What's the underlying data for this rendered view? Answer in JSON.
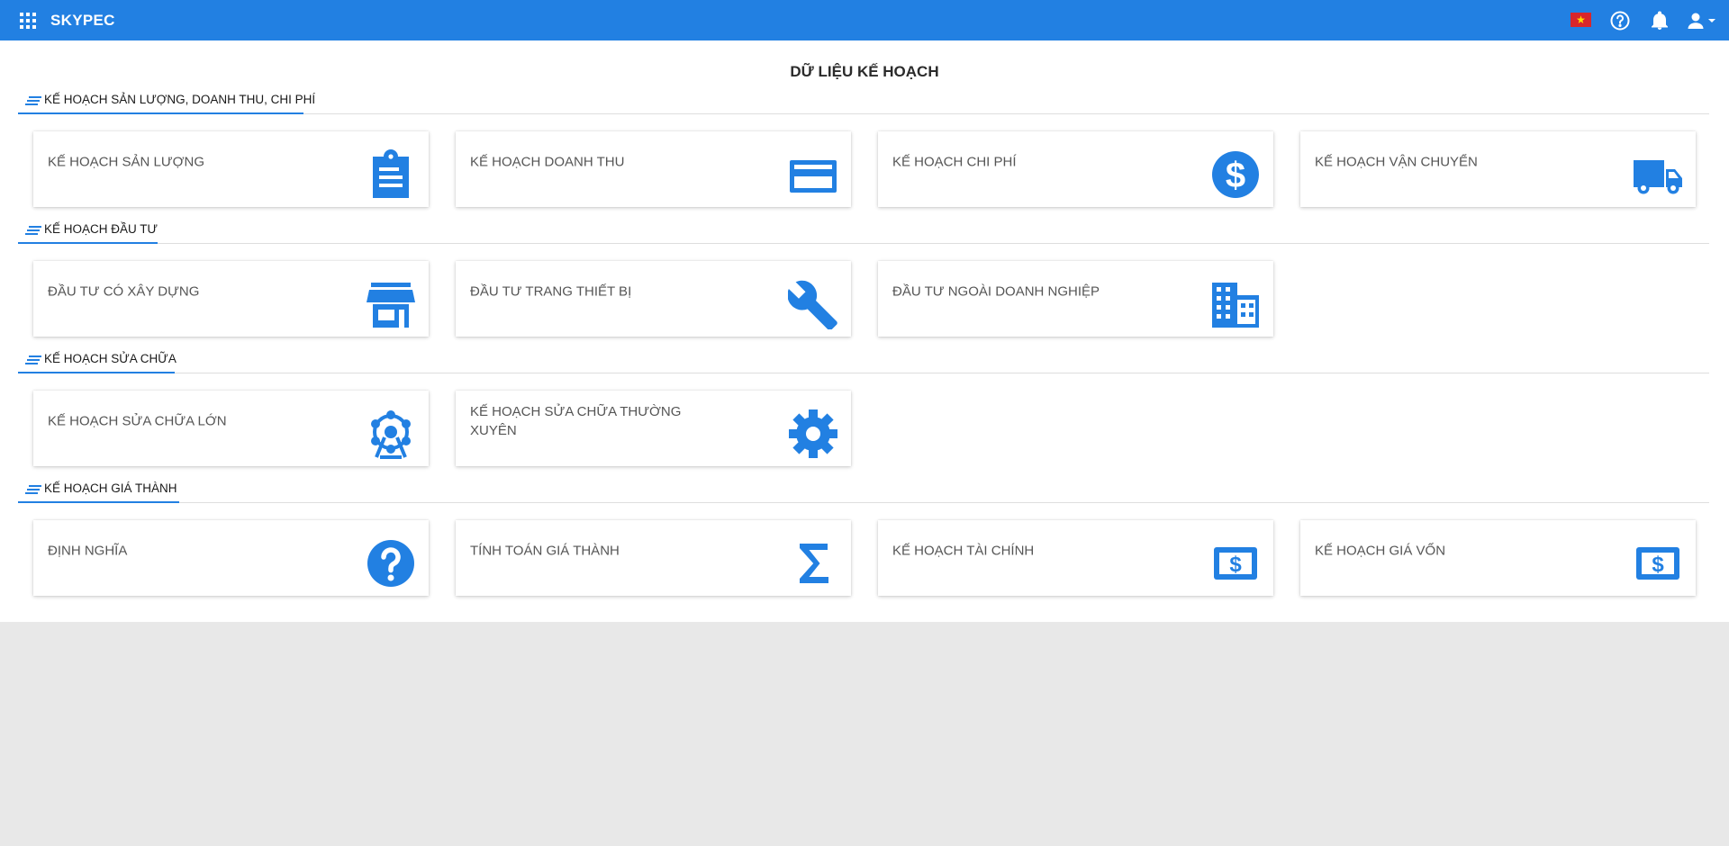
{
  "app": {
    "title": "SKYPEC"
  },
  "topbar": {
    "icons": [
      "apps-grid-icon",
      "vietnam-flag-icon",
      "help-circle-icon",
      "bell-icon",
      "user-menu-icon"
    ]
  },
  "page": {
    "title": "DỮ LIỆU KẾ HOẠCH"
  },
  "colors": {
    "brand": "#2280e2",
    "icon": "#2280e2",
    "page_bg": "#e8e8e8"
  },
  "sections": [
    {
      "title": "KẾ HOẠCH SẢN LƯỢNG, DOANH THU, CHI PHÍ",
      "cards": [
        {
          "label": "KẾ HOẠCH SẢN LƯỢNG",
          "icon": "clipboard-icon"
        },
        {
          "label": "KẾ HOẠCH DOANH THU",
          "icon": "credit-card-icon"
        },
        {
          "label": "KẾ HOẠCH CHI PHÍ",
          "icon": "dollar-circle-icon"
        },
        {
          "label": "KẾ HOẠCH VẬN CHUYỂN",
          "icon": "truck-icon"
        }
      ]
    },
    {
      "title": "KẾ HOẠCH ĐẦU TƯ",
      "cards": [
        {
          "label": "ĐẦU TƯ CÓ XÂY DỰNG",
          "icon": "store-icon"
        },
        {
          "label": "ĐẦU TƯ TRANG THIẾT BỊ",
          "icon": "wrench-icon"
        },
        {
          "label": "ĐẦU TƯ NGOÀI DOANH NGHIỆP",
          "icon": "building-icon"
        }
      ]
    },
    {
      "title": "KẾ HOẠCH SỬA CHỮA",
      "cards": [
        {
          "label": "KẾ HOẠCH SỬA CHỮA LỚN",
          "icon": "ferris-wheel-icon"
        },
        {
          "label": "KẾ HOẠCH SỬA CHỮA THƯỜNG XUYÊN",
          "icon": "gear-icon"
        }
      ]
    },
    {
      "title": "KẾ HOẠCH GIÁ THÀNH",
      "cards": [
        {
          "label": "ĐỊNH NGHĨA",
          "icon": "question-circle-icon"
        },
        {
          "label": "TÍNH TOÁN GIÁ THÀNH",
          "icon": "sigma-icon"
        },
        {
          "label": "KẾ HOẠCH TÀI CHÍNH",
          "icon": "money-icon"
        },
        {
          "label": "KẾ HOẠCH GIÁ VỐN",
          "icon": "money-icon"
        }
      ]
    }
  ]
}
